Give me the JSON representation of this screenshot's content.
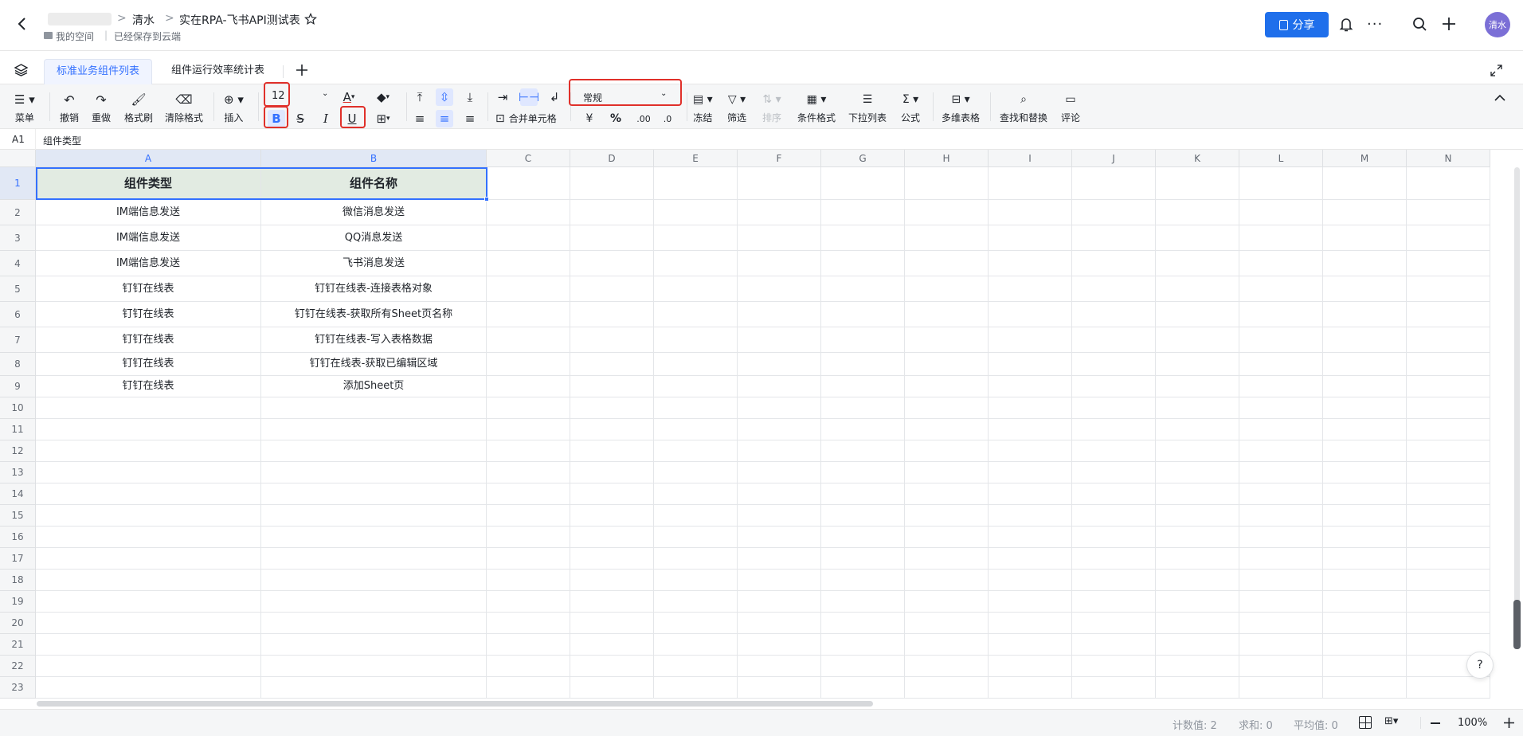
{
  "header": {
    "breadcrumb_parent": "清水",
    "doc_title": "实在RPA-飞书API测试表",
    "location": "我的空间",
    "save_status": "已经保存到云端",
    "share_label": "分享",
    "avatar_text": "清水"
  },
  "tabs": [
    {
      "label": "标准业务组件列表",
      "active": true
    },
    {
      "label": "组件运行效率统计表",
      "active": false
    }
  ],
  "toolbar": {
    "menu": "菜单",
    "undo": "撤销",
    "redo": "重做",
    "format_painter": "格式刷",
    "clear_format": "清除格式",
    "insert": "插入",
    "font_size": "12",
    "merge_cells": "合并单元格",
    "number_format": "常规",
    "freeze": "冻结",
    "filter": "筛选",
    "sort": "排序",
    "conditional_format": "条件格式",
    "dropdown_list": "下拉列表",
    "formula": "公式",
    "multi_table": "多维表格",
    "find_replace": "查找和替换",
    "comment": "评论",
    "currency_symbol": "¥",
    "percent_symbol": "%",
    "decimal_inc": ".00",
    "decimal_dec": ".0"
  },
  "formula_bar": {
    "cell_ref": "A1",
    "content": "组件类型"
  },
  "sheet": {
    "columns": [
      "A",
      "B",
      "C",
      "D",
      "E",
      "F",
      "G",
      "H",
      "I",
      "J",
      "K",
      "L",
      "M",
      "N"
    ],
    "rows": [
      "1",
      "2",
      "3",
      "4",
      "5",
      "6",
      "7",
      "8",
      "9",
      "10",
      "11",
      "12",
      "13",
      "14",
      "15",
      "16",
      "17",
      "18",
      "19",
      "20",
      "21",
      "22",
      "23"
    ],
    "header_row": [
      "组件类型",
      "组件名称"
    ],
    "data": [
      [
        "IM端信息发送",
        "微信消息发送"
      ],
      [
        "IM端信息发送",
        "QQ消息发送"
      ],
      [
        "IM端信息发送",
        "飞书消息发送"
      ],
      [
        "钉钉在线表",
        "钉钉在线表-连接表格对象"
      ],
      [
        "钉钉在线表",
        "钉钉在线表-获取所有Sheet页名称"
      ],
      [
        "钉钉在线表",
        "钉钉在线表-写入表格数据"
      ],
      [
        "钉钉在线表",
        "钉钉在线表-获取已编辑区域"
      ],
      [
        "钉钉在线表",
        "添加Sheet页"
      ]
    ]
  },
  "status_bar": {
    "count": "计数值: 2",
    "sum": "求和: 0",
    "average": "平均值: 0",
    "zoom": "100%"
  },
  "colors": {
    "accent": "#3370ff",
    "share_button": "#1f6feb",
    "header_cell_bg": "#e2ebe2",
    "highlight_box": "#e0302a"
  }
}
